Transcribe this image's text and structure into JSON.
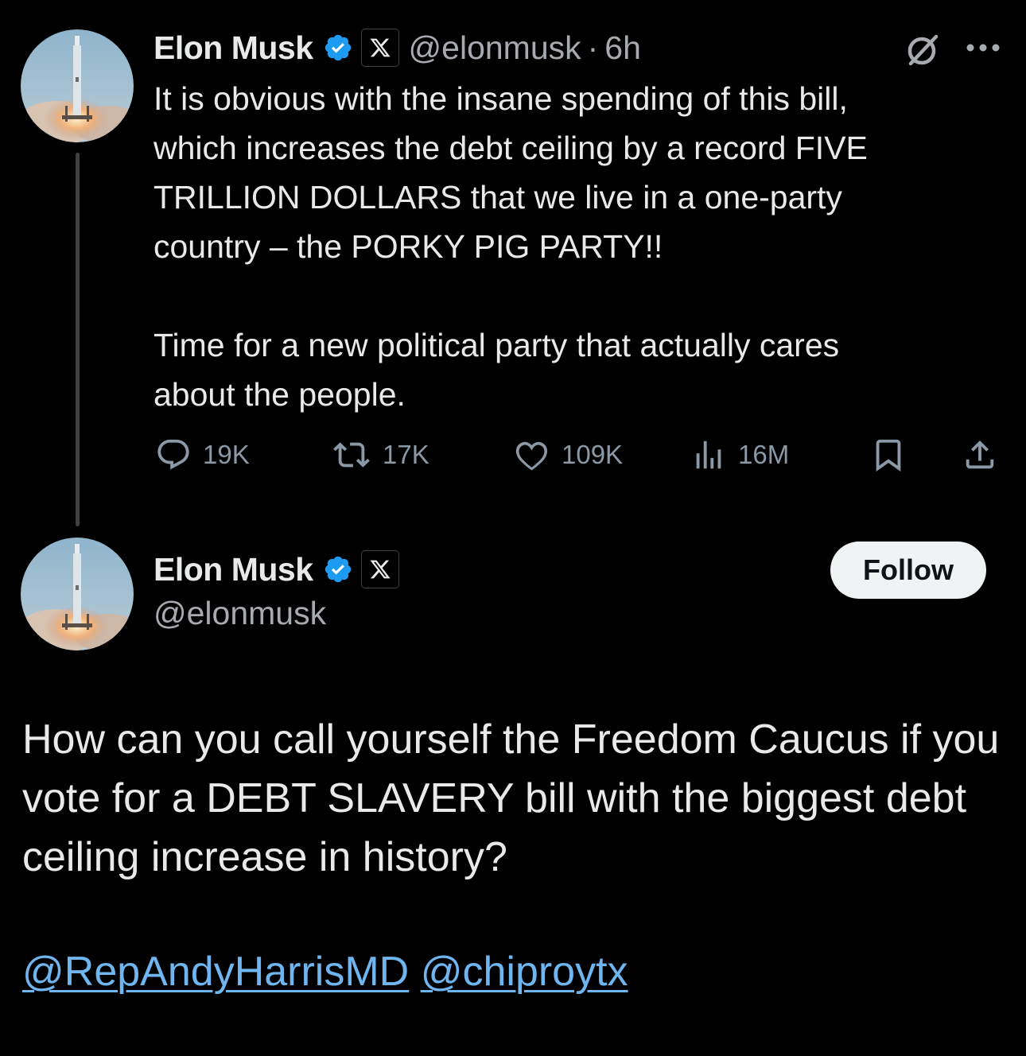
{
  "colors": {
    "background": "#000000",
    "text_primary": "#e7e9ea",
    "text_secondary": "#a7abb0",
    "verified_blue": "#1d9bf0",
    "link": "#6fb5ef",
    "thread_line": "#3e4144"
  },
  "first_post": {
    "author": {
      "name": "Elon Musk",
      "handle": "@elonmusk",
      "verified_icon": "verified-badge-icon",
      "affiliation_icon": "x-logo-icon",
      "avatar_icon": "rocket-launch-avatar"
    },
    "separator": "·",
    "time": "6h",
    "body": "It is obvious with the insane spending of this bill,\nwhich increases the debt ceiling by a record FIVE\nTRILLION DOLLARS that we live in a one-party\ncountry – the PORKY PIG PARTY!!\n\nTime for a new political party that actually cares\nabout the people.",
    "actions": {
      "replies": "19K",
      "reposts": "17K",
      "likes": "109K",
      "views": "16M"
    }
  },
  "second_post": {
    "author": {
      "name": "Elon Musk",
      "handle": "@elonmusk",
      "verified_icon": "verified-badge-icon",
      "affiliation_icon": "x-logo-icon",
      "avatar_icon": "rocket-launch-avatar"
    },
    "follow_label": "Follow",
    "body": "How can you call yourself the Freedom Caucus if you vote for a DEBT SLAVERY bill with the biggest debt ceiling increase in history?",
    "mentions": [
      "@RepAndyHarrisMD",
      "@chiproytx"
    ]
  }
}
